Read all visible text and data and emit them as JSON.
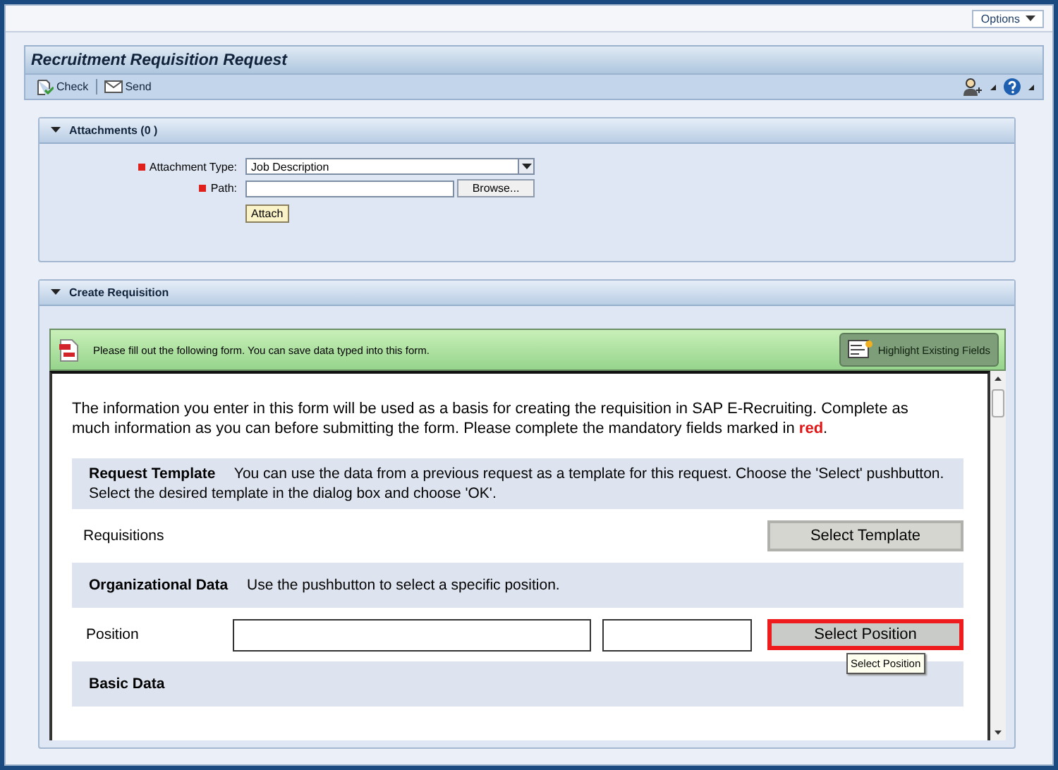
{
  "top_bar": {
    "options_button": "Options"
  },
  "page": {
    "title": "Recruitment Requisition Request"
  },
  "toolbar": {
    "buttons": [
      {
        "label": "Check",
        "kind": "check"
      },
      {
        "label": "Send",
        "kind": "send"
      }
    ]
  },
  "attachments": {
    "title": "Attachments (0 )",
    "expanded": true,
    "fields": [
      {
        "label": "Attachment Type:",
        "required": true,
        "kind": "dropdown",
        "value": "Job Description"
      },
      {
        "label": "Path:",
        "required": true,
        "kind": "file",
        "button": "Browse..."
      }
    ],
    "attach_button": "Attach"
  },
  "create_requisition": {
    "title": "Create Requisition",
    "expanded": true,
    "notice": "Please fill out the following form. You can save data typed into this form.",
    "highlight_button": "Highlight Existing Fields",
    "intro": "The information you enter in this form will be used as a basis for creating the requisition in SAP E-Recruiting. Complete as much information as you can before submitting the form. Please complete the mandatory fields marked in **red**.",
    "rows": [
      {
        "kind": "section",
        "title": "Request Template",
        "description": "You can use the data from a previous request as a template for this request. Choose the 'Select' pushbutton. Select the desired template in the dialog box and choose 'OK'."
      },
      {
        "kind": "button_row",
        "label": "Requisitions",
        "button": "Select Template",
        "highlighted": false
      },
      {
        "kind": "section",
        "title": "Organizational Data",
        "description": "Use the pushbutton to select a specific position."
      },
      {
        "kind": "field_row",
        "label": "Position",
        "button": "Select Position",
        "highlighted": true,
        "tooltip": "Select Position"
      },
      {
        "kind": "section",
        "title": "Basic Data"
      }
    ]
  }
}
